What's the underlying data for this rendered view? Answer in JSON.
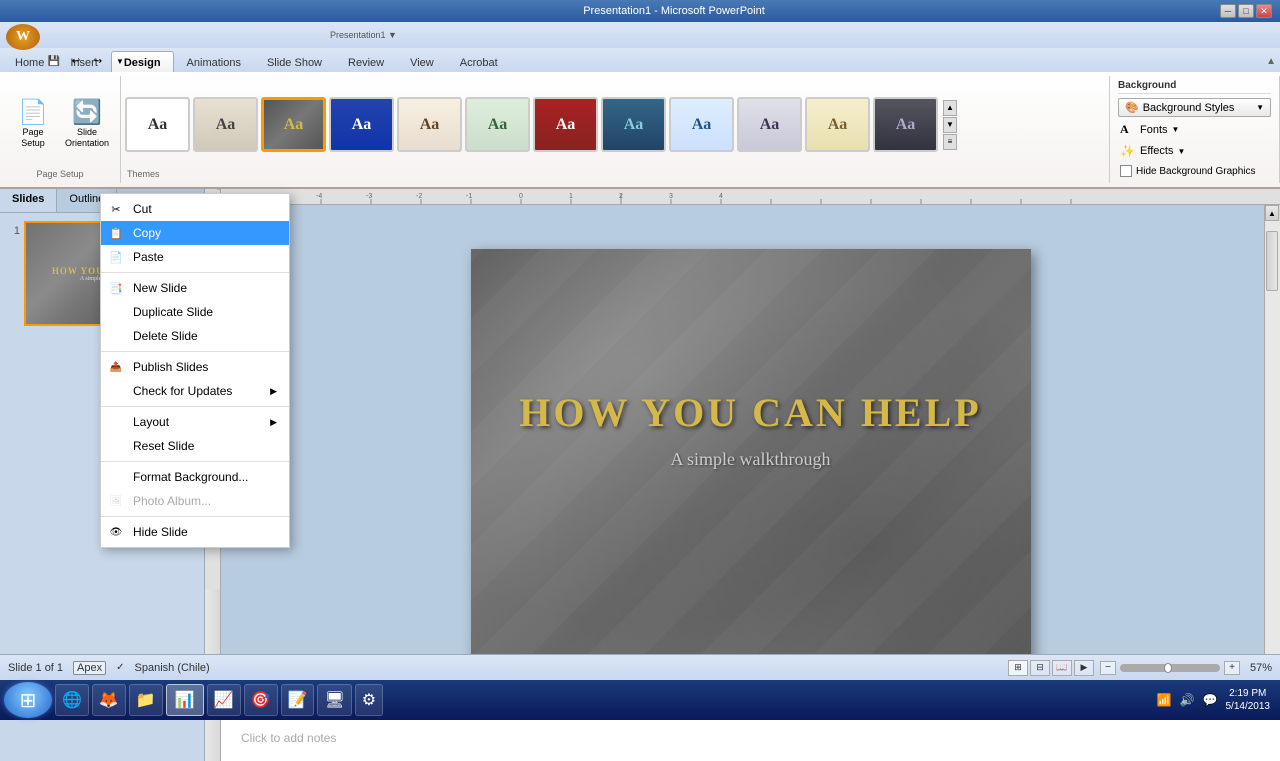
{
  "titlebar": {
    "text": "Presentation1 - Microsoft PowerPoint",
    "minimize": "─",
    "restore": "□",
    "close": "✕"
  },
  "quickaccess": {
    "save": "💾",
    "undo": "↩",
    "redo": "↪"
  },
  "tabs": [
    {
      "id": "home",
      "label": "Home"
    },
    {
      "id": "insert",
      "label": "Insert"
    },
    {
      "id": "design",
      "label": "Design",
      "active": true
    },
    {
      "id": "animations",
      "label": "Animations"
    },
    {
      "id": "slideshow",
      "label": "Slide Show"
    },
    {
      "id": "review",
      "label": "Review"
    },
    {
      "id": "view",
      "label": "View"
    },
    {
      "id": "acrobat",
      "label": "Acrobat"
    }
  ],
  "ribbon": {
    "pageSetup": {
      "label": "Page Setup",
      "pageSetupBtn": "Page Setup",
      "orientationBtn": "Slide Orientation"
    },
    "themes": {
      "label": "Themes"
    },
    "background": {
      "label": "Background",
      "backgroundStyles": "Background Styles",
      "fonts": "Fonts",
      "effects": "Effects",
      "hideBackgroundGraphics": "Hide Background Graphics",
      "dropdownArrow": "▼"
    }
  },
  "panelTabs": [
    {
      "id": "slides",
      "label": "Slides",
      "active": true
    },
    {
      "id": "outline",
      "label": "Outline"
    }
  ],
  "slide": {
    "title": "HOW YOU CAN HELP",
    "subtitle": "A simple walkthrough"
  },
  "notes": {
    "placeholder": "Click to add notes"
  },
  "contextMenu": {
    "items": [
      {
        "id": "cut",
        "label": "Cut",
        "icon": "✂",
        "hasIcon": true
      },
      {
        "id": "copy",
        "label": "Copy",
        "icon": "📋",
        "hasIcon": true,
        "highlighted": true
      },
      {
        "id": "paste",
        "label": "Paste",
        "icon": "📄",
        "hasIcon": true
      },
      {
        "id": "sep1",
        "type": "separator"
      },
      {
        "id": "new-slide",
        "label": "New Slide",
        "icon": "📑",
        "hasIcon": true
      },
      {
        "id": "duplicate-slide",
        "label": "Duplicate Slide",
        "hasIcon": false
      },
      {
        "id": "delete-slide",
        "label": "Delete Slide",
        "hasIcon": false
      },
      {
        "id": "sep2",
        "type": "separator"
      },
      {
        "id": "publish-slides",
        "label": "Publish Slides",
        "icon": "📤",
        "hasIcon": true
      },
      {
        "id": "check-updates",
        "label": "Check for Updates",
        "hasArrow": true
      },
      {
        "id": "sep3",
        "type": "separator"
      },
      {
        "id": "layout",
        "label": "Layout",
        "hasArrow": true
      },
      {
        "id": "reset-slide",
        "label": "Reset Slide",
        "hasIcon": false
      },
      {
        "id": "sep4",
        "type": "separator"
      },
      {
        "id": "format-background",
        "label": "Format Background...",
        "hasIcon": false
      },
      {
        "id": "photo-album",
        "label": "Photo Album...",
        "hasIcon": false,
        "disabled": true
      },
      {
        "id": "sep5",
        "type": "separator"
      },
      {
        "id": "hide-slide",
        "label": "Hide Slide",
        "icon": "👁",
        "hasIcon": true
      }
    ]
  },
  "statusBar": {
    "slideInfo": "Slide 1 of 1",
    "theme": "Apex",
    "language": "Spanish (Chile)",
    "zoom": "57%"
  },
  "taskbar": {
    "start": "⊞",
    "apps": [
      {
        "id": "chrome",
        "icon": "🌐",
        "label": ""
      },
      {
        "id": "firefox",
        "icon": "🦊",
        "label": ""
      },
      {
        "id": "folder",
        "icon": "📁",
        "label": ""
      },
      {
        "id": "powerpoint",
        "icon": "📊",
        "label": "",
        "active": true
      },
      {
        "id": "excel",
        "icon": "📈",
        "label": ""
      },
      {
        "id": "pp2",
        "icon": "🎯",
        "label": ""
      },
      {
        "id": "word",
        "icon": "📝",
        "label": ""
      },
      {
        "id": "network",
        "icon": "🖥",
        "label": ""
      },
      {
        "id": "app9",
        "icon": "⚙",
        "label": ""
      }
    ],
    "tray": {
      "time": "2:19 PM",
      "date": "5/14/2013"
    }
  }
}
